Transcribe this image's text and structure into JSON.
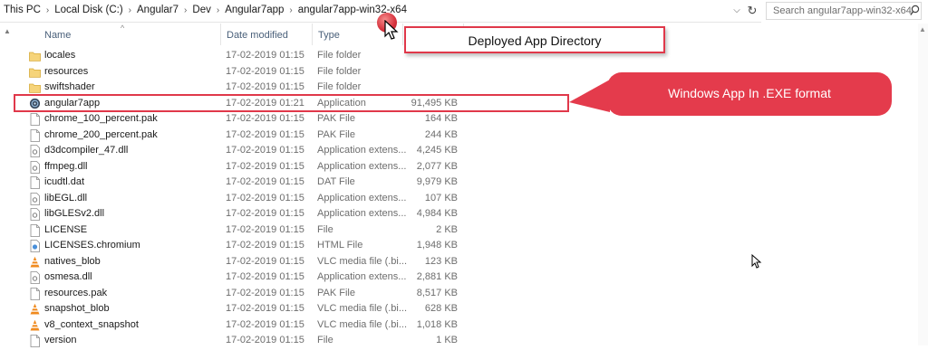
{
  "address": {
    "crumbs": [
      "This PC",
      "Local Disk (C:)",
      "Angular7",
      "Dev",
      "Angular7app",
      "angular7app-win32-x64"
    ],
    "separator": "›",
    "dropdown_icon": "chevron-down-icon",
    "refresh_icon": "refresh-icon"
  },
  "search": {
    "placeholder": "Search angular7app-win32-x64",
    "icon": "search-icon"
  },
  "columns": {
    "name": "Name",
    "date": "Date modified",
    "type": "Type",
    "size": ""
  },
  "files": [
    {
      "name": "locales",
      "date": "17-02-2019 01:15",
      "type": "File folder",
      "size": "",
      "icon": "folder-icon"
    },
    {
      "name": "resources",
      "date": "17-02-2019 01:15",
      "type": "File folder",
      "size": "",
      "icon": "folder-icon"
    },
    {
      "name": "swiftshader",
      "date": "17-02-2019 01:15",
      "type": "File folder",
      "size": "",
      "icon": "folder-icon"
    },
    {
      "name": "angular7app",
      "date": "17-02-2019 01:21",
      "type": "Application",
      "size": "91,495 KB",
      "icon": "app-exe-icon"
    },
    {
      "name": "chrome_100_percent.pak",
      "date": "17-02-2019 01:15",
      "type": "PAK File",
      "size": "164 KB",
      "icon": "file-icon"
    },
    {
      "name": "chrome_200_percent.pak",
      "date": "17-02-2019 01:15",
      "type": "PAK File",
      "size": "244 KB",
      "icon": "file-icon"
    },
    {
      "name": "d3dcompiler_47.dll",
      "date": "17-02-2019 01:15",
      "type": "Application extens...",
      "size": "4,245 KB",
      "icon": "dll-icon"
    },
    {
      "name": "ffmpeg.dll",
      "date": "17-02-2019 01:15",
      "type": "Application extens...",
      "size": "2,077 KB",
      "icon": "dll-icon"
    },
    {
      "name": "icudtl.dat",
      "date": "17-02-2019 01:15",
      "type": "DAT File",
      "size": "9,979 KB",
      "icon": "file-icon"
    },
    {
      "name": "libEGL.dll",
      "date": "17-02-2019 01:15",
      "type": "Application extens...",
      "size": "107 KB",
      "icon": "dll-icon"
    },
    {
      "name": "libGLESv2.dll",
      "date": "17-02-2019 01:15",
      "type": "Application extens...",
      "size": "4,984 KB",
      "icon": "dll-icon"
    },
    {
      "name": "LICENSE",
      "date": "17-02-2019 01:15",
      "type": "File",
      "size": "2 KB",
      "icon": "file-icon"
    },
    {
      "name": "LICENSES.chromium",
      "date": "17-02-2019 01:15",
      "type": "HTML File",
      "size": "1,948 KB",
      "icon": "html-file-icon"
    },
    {
      "name": "natives_blob",
      "date": "17-02-2019 01:15",
      "type": "VLC media file (.bi...",
      "size": "123 KB",
      "icon": "vlc-icon"
    },
    {
      "name": "osmesa.dll",
      "date": "17-02-2019 01:15",
      "type": "Application extens...",
      "size": "2,881 KB",
      "icon": "dll-icon"
    },
    {
      "name": "resources.pak",
      "date": "17-02-2019 01:15",
      "type": "PAK File",
      "size": "8,517 KB",
      "icon": "file-icon"
    },
    {
      "name": "snapshot_blob",
      "date": "17-02-2019 01:15",
      "type": "VLC media file (.bi...",
      "size": "628 KB",
      "icon": "vlc-icon"
    },
    {
      "name": "v8_context_snapshot",
      "date": "17-02-2019 01:15",
      "type": "VLC media file (.bi...",
      "size": "1,018 KB",
      "icon": "vlc-icon"
    },
    {
      "name": "version",
      "date": "17-02-2019 01:15",
      "type": "File",
      "size": "1 KB",
      "icon": "file-icon"
    }
  ],
  "annotations": {
    "deploy_label": "Deployed App Directory",
    "exe_label": "Windows App In .EXE format",
    "accent": "#e0384a"
  }
}
